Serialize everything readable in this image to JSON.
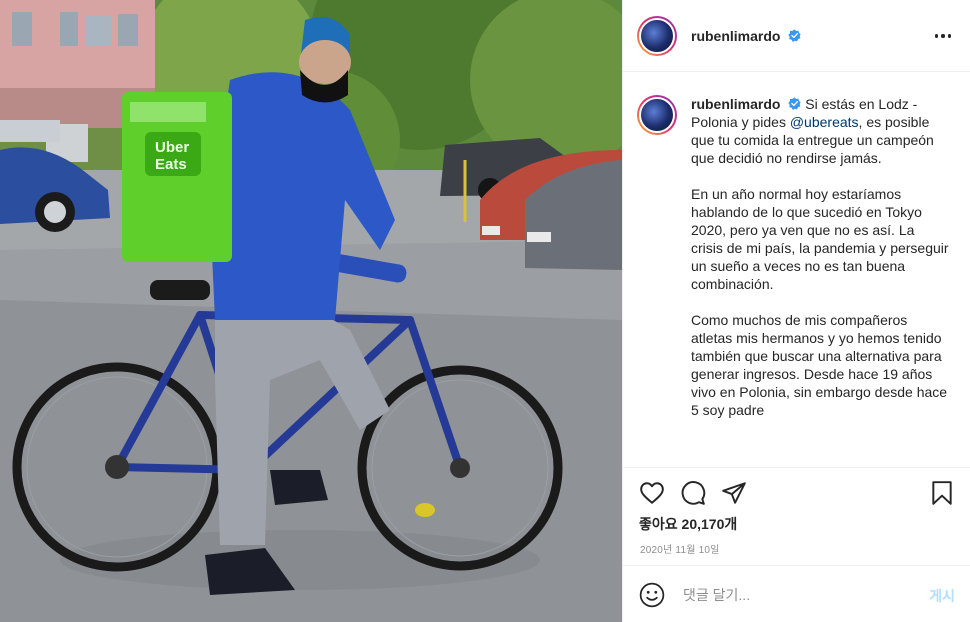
{
  "photo": {
    "description_icon": "photo-image",
    "bag_logo_line1": "Uber",
    "bag_logo_line2": "Eats"
  },
  "header": {
    "username": "rubenlimardo",
    "verified_icon": "verified-badge-icon",
    "more_icon": "more-options-icon"
  },
  "caption": {
    "username": "rubenlimardo",
    "para1_before_mention": "Si estás en Lodz - Polonia y pides ",
    "mention": "@ubereats",
    "para1_after_mention": ", es posible que tu comida la entregue un campeón que decidió no rendirse jamás.",
    "para2": "En un año normal hoy estaríamos hablando de lo que sucedió en Tokyo 2020, pero ya ven que no es así. La crisis de mi país, la pandemia y perseguir un sueño a veces no es tan buena combinación.",
    "para3": "Como muchos de mis compañeros atletas mis hermanos y yo hemos tenido también que buscar una alternativa para generar ingresos. Desde hace 19 años vivo en Polonia, sin embargo desde hace 5 soy padre"
  },
  "actions": {
    "like_icon": "heart-icon",
    "comment_icon": "comment-icon",
    "share_icon": "send-icon",
    "save_icon": "bookmark-icon",
    "likes_text": "좋아요 20,170개",
    "date_text": "2020년 11월 10일"
  },
  "comment": {
    "emoji_icon": "emoji-icon",
    "placeholder": "댓글 달기...",
    "post_label": "게시"
  },
  "colors": {
    "link": "#00376b",
    "post_button_disabled": "#b2dffc",
    "meta_text": "#8e8e8e",
    "uber_eats_green": "#5fcf2b"
  }
}
